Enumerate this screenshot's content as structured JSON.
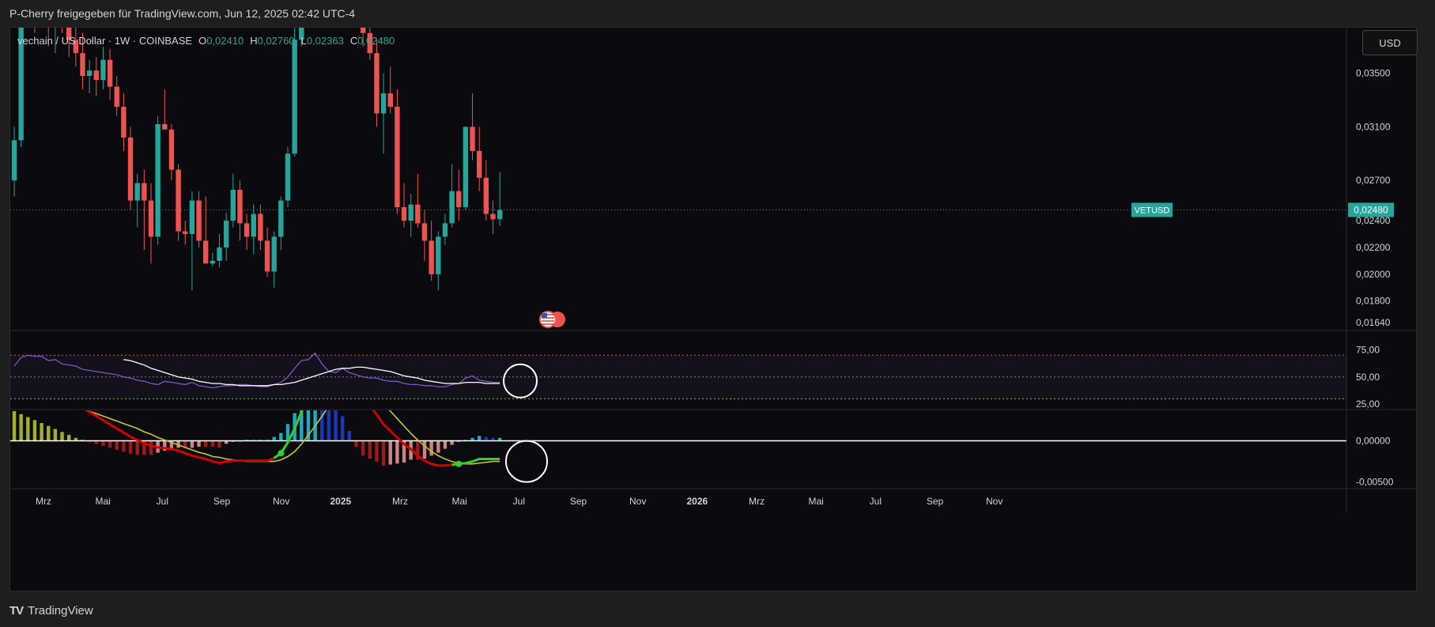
{
  "header": {
    "shared_by": "P-Cherry freigegeben für TradingView.com, Jun 12, 2025 02:42 UTC-4"
  },
  "legend": {
    "symbol": "vechain / US Dollar · 1W · COINBASE",
    "o_label": "O",
    "o_value": "0,02410",
    "h_label": "H",
    "h_value": "0,02760",
    "l_label": "L",
    "l_value": "0,02363",
    "c_label": "C",
    "c_value": "0,02480"
  },
  "currency_button": "USD",
  "footer": {
    "brand": "TradingView"
  },
  "colors": {
    "up": "#26a69a",
    "down": "#ef5350",
    "rsi": "#7e57c2",
    "rsi_ma": "#ffffff",
    "macd": "#d50000",
    "signal": "#c0ca33",
    "bg": "#0b0b0f"
  },
  "chart_data": [
    {
      "type": "candlestick",
      "title": "vechain / US Dollar · 1W · COINBASE",
      "price_label": {
        "symbol": "VETUSD",
        "value": "0,02480"
      },
      "y_ticks": [
        "0,03500",
        "0,03100",
        "0,02700",
        "0,02400",
        "0,02200",
        "0,02000",
        "0,01800",
        "0,01640"
      ],
      "y_tick_values": [
        0.035,
        0.031,
        0.027,
        0.024,
        0.022,
        0.02,
        0.018,
        0.0164
      ],
      "ylim": [
        0.0158,
        0.0384
      ],
      "x_ticks": [
        "Mrz",
        "Mai",
        "Jul",
        "Sep",
        "Nov",
        "2025",
        "Mrz",
        "Mai",
        "Jul",
        "Sep",
        "Nov",
        "2026",
        "Mrz",
        "Mai",
        "Jul",
        "Sep",
        "Nov"
      ],
      "candles": [
        {
          "o": 0.027,
          "h": 0.031,
          "l": 0.0258,
          "c": 0.03
        },
        {
          "o": 0.03,
          "h": 0.042,
          "l": 0.0295,
          "c": 0.0415
        },
        {
          "o": 0.0415,
          "h": 0.044,
          "l": 0.0395,
          "c": 0.042
        },
        {
          "o": 0.042,
          "h": 0.0435,
          "l": 0.038,
          "c": 0.041
        },
        {
          "o": 0.041,
          "h": 0.0425,
          "l": 0.0385,
          "c": 0.04
        },
        {
          "o": 0.04,
          "h": 0.0415,
          "l": 0.037,
          "c": 0.039
        },
        {
          "o": 0.039,
          "h": 0.0412,
          "l": 0.0365,
          "c": 0.0405
        },
        {
          "o": 0.0405,
          "h": 0.041,
          "l": 0.038,
          "c": 0.0395
        },
        {
          "o": 0.0395,
          "h": 0.0405,
          "l": 0.0362,
          "c": 0.0375
        },
        {
          "o": 0.0375,
          "h": 0.039,
          "l": 0.0355,
          "c": 0.0365
        },
        {
          "o": 0.0365,
          "h": 0.038,
          "l": 0.0338,
          "c": 0.0348
        },
        {
          "o": 0.0348,
          "h": 0.036,
          "l": 0.0335,
          "c": 0.0352
        },
        {
          "o": 0.0352,
          "h": 0.0362,
          "l": 0.0333,
          "c": 0.0345
        },
        {
          "o": 0.0345,
          "h": 0.037,
          "l": 0.0338,
          "c": 0.036
        },
        {
          "o": 0.036,
          "h": 0.0368,
          "l": 0.033,
          "c": 0.034
        },
        {
          "o": 0.034,
          "h": 0.0348,
          "l": 0.0318,
          "c": 0.0325
        },
        {
          "o": 0.0325,
          "h": 0.0335,
          "l": 0.0292,
          "c": 0.0302
        },
        {
          "o": 0.0302,
          "h": 0.031,
          "l": 0.0248,
          "c": 0.0255
        },
        {
          "o": 0.0255,
          "h": 0.0275,
          "l": 0.0235,
          "c": 0.0268
        },
        {
          "o": 0.0268,
          "h": 0.0278,
          "l": 0.0218,
          "c": 0.0255
        },
        {
          "o": 0.0255,
          "h": 0.0268,
          "l": 0.0208,
          "c": 0.0228
        },
        {
          "o": 0.0228,
          "h": 0.0318,
          "l": 0.0222,
          "c": 0.0312
        },
        {
          "o": 0.0312,
          "h": 0.0338,
          "l": 0.0308,
          "c": 0.0308
        },
        {
          "o": 0.0308,
          "h": 0.0312,
          "l": 0.027,
          "c": 0.0278
        },
        {
          "o": 0.0278,
          "h": 0.0282,
          "l": 0.0225,
          "c": 0.0232
        },
        {
          "o": 0.0232,
          "h": 0.024,
          "l": 0.0222,
          "c": 0.023
        },
        {
          "o": 0.023,
          "h": 0.0262,
          "l": 0.0188,
          "c": 0.0255
        },
        {
          "o": 0.0255,
          "h": 0.0262,
          "l": 0.022,
          "c": 0.0225
        },
        {
          "o": 0.0225,
          "h": 0.0258,
          "l": 0.0208,
          "c": 0.0208
        },
        {
          "o": 0.0208,
          "h": 0.0216,
          "l": 0.0206,
          "c": 0.021
        },
        {
          "o": 0.021,
          "h": 0.023,
          "l": 0.0205,
          "c": 0.022
        },
        {
          "o": 0.022,
          "h": 0.0246,
          "l": 0.021,
          "c": 0.024
        },
        {
          "o": 0.024,
          "h": 0.0275,
          "l": 0.0235,
          "c": 0.0263
        },
        {
          "o": 0.0263,
          "h": 0.027,
          "l": 0.0225,
          "c": 0.0238
        },
        {
          "o": 0.0238,
          "h": 0.0245,
          "l": 0.0218,
          "c": 0.0228
        },
        {
          "o": 0.0228,
          "h": 0.0252,
          "l": 0.0215,
          "c": 0.0245
        },
        {
          "o": 0.0245,
          "h": 0.0252,
          "l": 0.0218,
          "c": 0.0225
        },
        {
          "o": 0.0225,
          "h": 0.0235,
          "l": 0.0198,
          "c": 0.0202
        },
        {
          "o": 0.0202,
          "h": 0.0232,
          "l": 0.019,
          "c": 0.0228
        },
        {
          "o": 0.0228,
          "h": 0.0258,
          "l": 0.0218,
          "c": 0.0255
        },
        {
          "o": 0.0255,
          "h": 0.0295,
          "l": 0.025,
          "c": 0.029
        },
        {
          "o": 0.029,
          "h": 0.0385,
          "l": 0.0288,
          "c": 0.0375
        },
        {
          "o": 0.0375,
          "h": 0.044,
          "l": 0.037,
          "c": 0.043
        },
        {
          "o": 0.043,
          "h": 0.048,
          "l": 0.04,
          "c": 0.042
        },
        {
          "o": 0.042,
          "h": 0.046,
          "l": 0.0395,
          "c": 0.0445
        },
        {
          "o": 0.0445,
          "h": 0.0455,
          "l": 0.0405,
          "c": 0.041
        },
        {
          "o": 0.041,
          "h": 0.0425,
          "l": 0.0385,
          "c": 0.04
        },
        {
          "o": 0.04,
          "h": 0.047,
          "l": 0.0395,
          "c": 0.046
        },
        {
          "o": 0.046,
          "h": 0.049,
          "l": 0.041,
          "c": 0.042
        },
        {
          "o": 0.042,
          "h": 0.044,
          "l": 0.039,
          "c": 0.043
        },
        {
          "o": 0.043,
          "h": 0.045,
          "l": 0.0395,
          "c": 0.0405
        },
        {
          "o": 0.0405,
          "h": 0.042,
          "l": 0.037,
          "c": 0.038
        },
        {
          "o": 0.038,
          "h": 0.04,
          "l": 0.036,
          "c": 0.0365
        },
        {
          "o": 0.0365,
          "h": 0.0375,
          "l": 0.031,
          "c": 0.032
        },
        {
          "o": 0.032,
          "h": 0.035,
          "l": 0.029,
          "c": 0.0335
        },
        {
          "o": 0.0335,
          "h": 0.0355,
          "l": 0.032,
          "c": 0.0325
        },
        {
          "o": 0.0325,
          "h": 0.0338,
          "l": 0.0245,
          "c": 0.025
        },
        {
          "o": 0.025,
          "h": 0.0268,
          "l": 0.0235,
          "c": 0.024
        },
        {
          "o": 0.024,
          "h": 0.026,
          "l": 0.0228,
          "c": 0.0252
        },
        {
          "o": 0.0252,
          "h": 0.0275,
          "l": 0.0235,
          "c": 0.0238
        },
        {
          "o": 0.0238,
          "h": 0.0248,
          "l": 0.021,
          "c": 0.0225
        },
        {
          "o": 0.0225,
          "h": 0.024,
          "l": 0.0195,
          "c": 0.02
        },
        {
          "o": 0.02,
          "h": 0.0232,
          "l": 0.0188,
          "c": 0.0228
        },
        {
          "o": 0.0228,
          "h": 0.0245,
          "l": 0.0222,
          "c": 0.0238
        },
        {
          "o": 0.0238,
          "h": 0.0282,
          "l": 0.0235,
          "c": 0.0262
        },
        {
          "o": 0.0262,
          "h": 0.0278,
          "l": 0.024,
          "c": 0.025
        },
        {
          "o": 0.025,
          "h": 0.031,
          "l": 0.0248,
          "c": 0.031
        },
        {
          "o": 0.031,
          "h": 0.0335,
          "l": 0.0285,
          "c": 0.0292
        },
        {
          "o": 0.0292,
          "h": 0.031,
          "l": 0.0262,
          "c": 0.0272
        },
        {
          "o": 0.0272,
          "h": 0.0285,
          "l": 0.024,
          "c": 0.0245
        },
        {
          "o": 0.0245,
          "h": 0.0255,
          "l": 0.023,
          "c": 0.0241
        },
        {
          "o": 0.0241,
          "h": 0.0276,
          "l": 0.0236,
          "c": 0.0248
        }
      ]
    },
    {
      "type": "line",
      "title": "RSI",
      "y_ticks": [
        "75,00",
        "50,00",
        "25,00"
      ],
      "y_tick_values": [
        75,
        50,
        25
      ],
      "ylim": [
        20,
        92
      ],
      "levels": [
        70,
        50,
        30
      ],
      "series": [
        {
          "key": "rsi",
          "values": [
            60,
            68,
            70,
            69,
            69,
            65,
            66,
            62,
            61,
            60,
            57,
            56,
            55,
            54,
            53,
            52,
            50,
            49,
            47,
            46,
            44,
            43,
            46,
            45,
            44,
            43,
            45,
            42,
            41,
            40,
            41,
            42,
            42,
            43,
            43,
            42,
            41,
            41,
            43,
            45,
            50,
            58,
            65,
            66,
            72,
            62,
            55,
            54,
            58,
            54,
            52,
            50,
            49,
            49,
            47,
            46,
            46,
            44,
            43,
            43,
            42,
            42,
            41,
            41,
            43,
            44,
            49,
            51,
            47,
            46,
            45,
            45
          ]
        },
        {
          "key": "rsi_ma",
          "values": [
            null,
            null,
            null,
            null,
            null,
            null,
            null,
            null,
            null,
            null,
            null,
            null,
            null,
            null,
            null,
            null,
            66,
            65,
            63,
            61,
            58,
            56,
            54,
            52,
            50,
            49,
            48,
            46,
            45,
            44,
            44,
            43,
            43,
            42,
            42,
            42,
            42,
            42,
            43,
            43,
            44,
            45,
            47,
            49,
            51,
            53,
            55,
            57,
            58,
            58,
            59,
            59,
            58,
            57,
            56,
            55,
            53,
            51,
            50,
            49,
            47,
            46,
            45,
            44,
            44,
            44,
            45,
            45,
            45,
            44,
            44,
            44
          ]
        }
      ]
    },
    {
      "type": "line",
      "title": "MACD",
      "y_ticks": [
        "0,00000",
        "-0,00500"
      ],
      "y_tick_values": [
        0,
        -0.005
      ],
      "ylim": [
        -0.0058,
        0.0037
      ],
      "series": [
        {
          "key": "macd",
          "values": [
            0.009,
            0.0085,
            0.008,
            0.0075,
            0.007,
            0.0065,
            0.006,
            0.0055,
            0.005,
            0.0045,
            0.004,
            0.0035,
            0.003,
            0.0025,
            0.002,
            0.0015,
            0.001,
            0.0005,
            0.0001,
            -0.0003,
            -0.0006,
            -0.0008,
            -0.0009,
            -0.001,
            -0.0012,
            -0.0015,
            -0.0018,
            -0.002,
            -0.0022,
            -0.0025,
            -0.0027,
            -0.0025,
            -0.0024,
            -0.0024,
            -0.0024,
            -0.0024,
            -0.0024,
            -0.0024,
            -0.0021,
            -0.0015,
            -0.0002,
            0.0015,
            0.0035,
            0.0052,
            0.0068,
            0.0078,
            0.0085,
            0.009,
            0.0085,
            0.0075,
            0.006,
            0.005,
            0.0042,
            0.0032,
            0.002,
            0.0012,
            0.0004,
            -0.0004,
            -0.001,
            -0.0018,
            -0.0024,
            -0.0028,
            -0.003,
            -0.003,
            -0.0029,
            -0.0028,
            -0.0027,
            -0.0025,
            -0.0022,
            -0.0022,
            -0.0022,
            -0.0022
          ]
        },
        {
          "key": "signal",
          "values": [
            0.006,
            0.0058,
            0.0056,
            0.0054,
            0.0052,
            0.005,
            0.0048,
            0.0046,
            0.0044,
            0.0042,
            0.0039,
            0.0036,
            0.0033,
            0.003,
            0.0027,
            0.0024,
            0.0021,
            0.0018,
            0.0015,
            0.0011,
            0.0008,
            0.0004,
            0.0001,
            -0.0002,
            -0.0005,
            -0.0008,
            -0.0011,
            -0.0014,
            -0.0016,
            -0.0019,
            -0.002,
            -0.0022,
            -0.0023,
            -0.0024,
            -0.0025,
            -0.0025,
            -0.0025,
            -0.0025,
            -0.0025,
            -0.0023,
            -0.0019,
            -0.0013,
            -0.0004,
            0.0007,
            0.0018,
            0.003,
            0.0042,
            0.0052,
            0.006,
            0.0065,
            0.0066,
            0.0065,
            0.006,
            0.0053,
            0.0045,
            0.0036,
            0.0027,
            0.0018,
            0.0009,
            0.0001,
            -0.0006,
            -0.0013,
            -0.0018,
            -0.0022,
            -0.0025,
            -0.0027,
            -0.0028,
            -0.0028,
            -0.0027,
            -0.0026,
            -0.0025,
            -0.0025
          ]
        }
      ]
    }
  ]
}
